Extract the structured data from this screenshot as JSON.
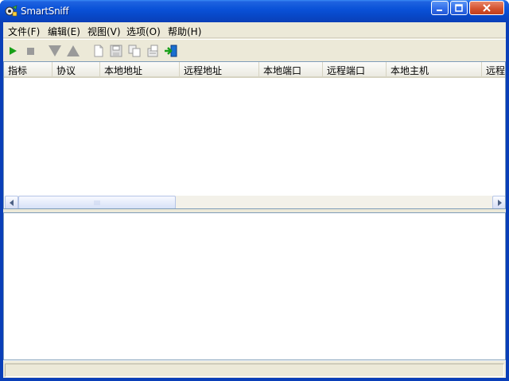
{
  "window": {
    "title": "SmartSniff"
  },
  "colors": {
    "titlebar": "#0a52d8",
    "client": "#ece9d8",
    "play": "#18a018"
  },
  "menu": {
    "items": [
      {
        "label": "文件(F)"
      },
      {
        "label": "编辑(E)"
      },
      {
        "label": "视图(V)"
      },
      {
        "label": "选项(O)"
      },
      {
        "label": "帮助(H)"
      }
    ]
  },
  "toolbar": {
    "buttons": [
      "play-icon",
      "stop-icon",
      "arrow-down-icon",
      "arrow-up-icon",
      "new-document-icon",
      "save-icon",
      "copy-icon",
      "properties-icon",
      "exit-icon"
    ]
  },
  "table": {
    "columns": [
      "指标",
      "协议",
      "本地地址",
      "远程地址",
      "本地端口",
      "远程端口",
      "本地主机",
      "远程"
    ]
  },
  "status": {
    "text": ""
  }
}
